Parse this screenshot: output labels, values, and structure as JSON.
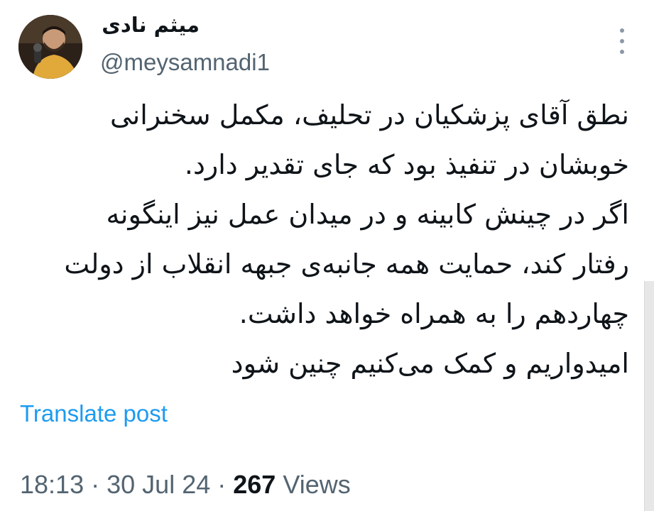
{
  "tweet": {
    "display_name": "میثم نادی",
    "handle": "@meysamnadi1",
    "body_lines": [
      "نطق آقای پزشکیان در تحلیف، مکمل سخنرانی",
      "خوبشان در تنفیذ بود که جای تقدیر دارد.",
      "اگر در چینش کابینه و در میدان عمل نیز اینگونه",
      "رفتار کند، حمایت همه جانبه‌ی جبهه انقلاب از دولت",
      "چهاردهم را به همراه خواهد داشت.",
      "امیدواریم و کمک می‌کنیم چنین شود"
    ],
    "translate_label": "Translate post",
    "time": "18:13",
    "date": "30 Jul 24",
    "separator": "·",
    "views_count": "267",
    "views_label": "Views"
  },
  "icons": {
    "avatar": "avatar-photo",
    "more": "more-vertical-icon"
  },
  "colors": {
    "text": "#0f1419",
    "secondary": "#536471",
    "link": "#1d9bf0",
    "background": "#ffffff"
  }
}
